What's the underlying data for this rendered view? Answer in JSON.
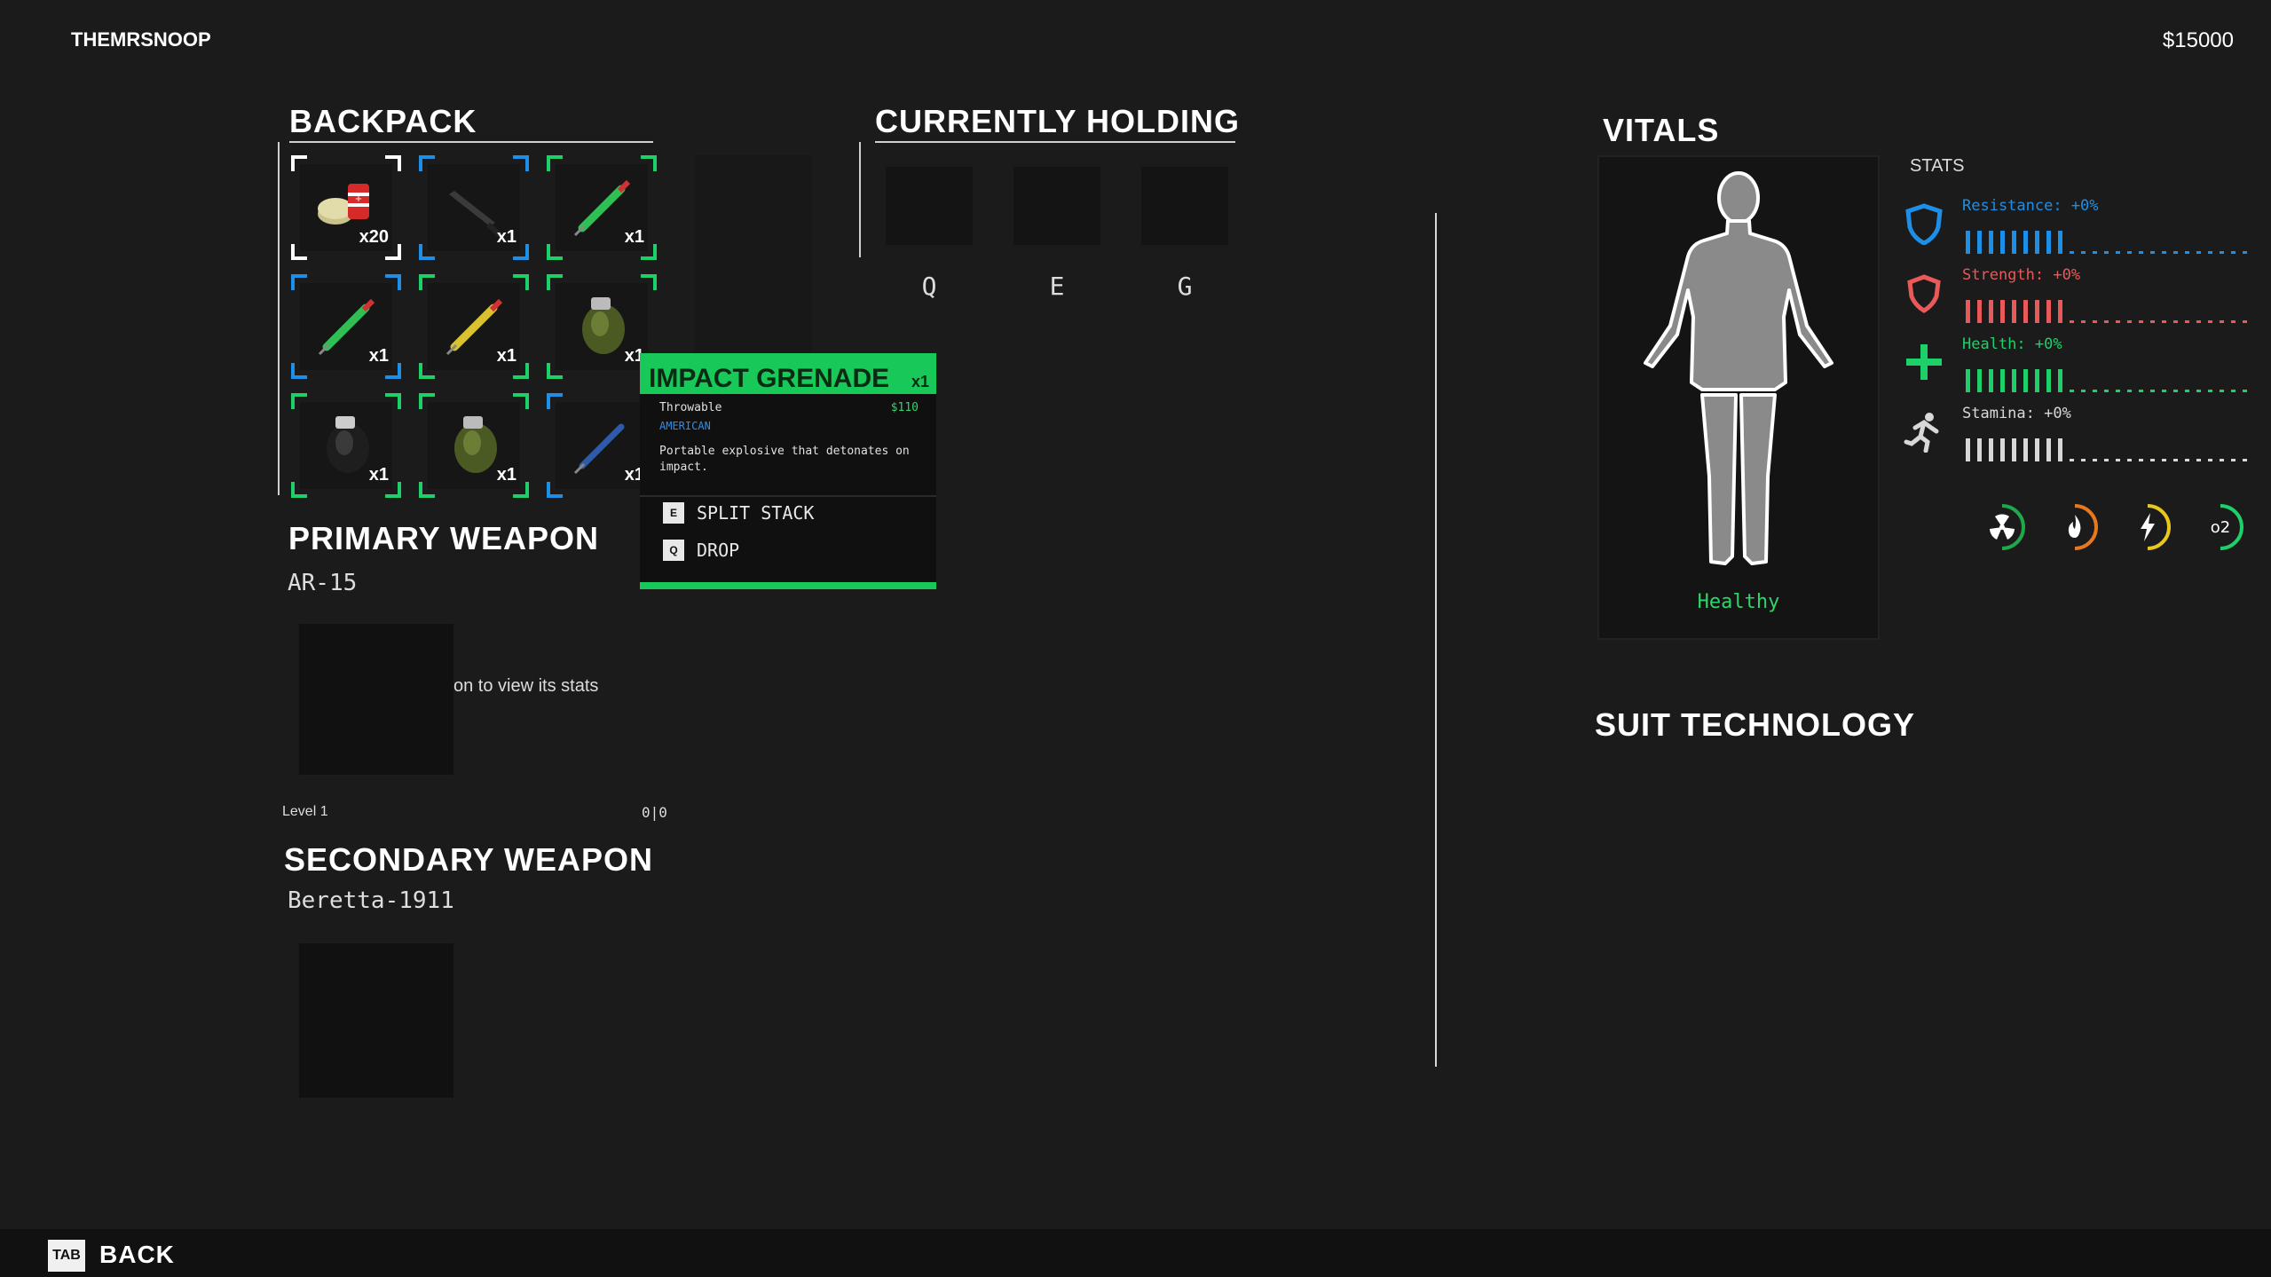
{
  "header": {
    "username": "THEMRSNOOP",
    "money": "$15000"
  },
  "backpack": {
    "title": "BACKPACK",
    "slots": [
      {
        "item": "ammo-cans",
        "qty": "x20",
        "frame_color": "#ffffff"
      },
      {
        "item": "knife",
        "qty": "x1",
        "frame_color": "#1e8fe6"
      },
      {
        "item": "green-syringe",
        "qty": "x1",
        "frame_color": "#1ed06a"
      },
      {
        "item": "green-syringe",
        "qty": "x1",
        "frame_color": "#1e8fe6"
      },
      {
        "item": "yellow-syringe",
        "qty": "x1",
        "frame_color": "#1ed06a"
      },
      {
        "item": "impact-grenade",
        "qty": "x1",
        "frame_color": "#1ed06a"
      },
      {
        "item": "frag-grenade",
        "qty": "x1",
        "frame_color": "#1ed06a"
      },
      {
        "item": "impact-grenade",
        "qty": "x1",
        "frame_color": "#1ed06a"
      },
      {
        "item": "blue-syringe",
        "qty": "x1",
        "frame_color": "#1e8fe6"
      }
    ]
  },
  "holding": {
    "title": "CURRENTLY HOLDING",
    "keys": [
      "Q",
      "E",
      "G"
    ]
  },
  "primary": {
    "title": "PRIMARY WEAPON",
    "name": "AR-15",
    "hint": "on to view its stats",
    "level": "Level 1",
    "ammo": "0|0"
  },
  "secondary": {
    "title": "SECONDARY WEAPON",
    "name": "Beretta-1911"
  },
  "tooltip": {
    "name": "IMPACT GRENADE",
    "qty": "x1",
    "type": "Throwable",
    "price": "$110",
    "origin": "AMERICAN",
    "description": "Portable explosive that detonates on impact.",
    "actions": [
      {
        "key": "E",
        "label": "SPLIT STACK"
      },
      {
        "key": "Q",
        "label": "DROP"
      }
    ],
    "accent": "#18c95a"
  },
  "vitals": {
    "title": "VITALS",
    "status": "Healthy",
    "stats_label": "STATS",
    "stats": [
      {
        "label": "Resistance: +0%",
        "color": "#1e8fe6",
        "icon": "shield-icon",
        "filled": 9,
        "total": 25
      },
      {
        "label": "Strength: +0%",
        "color": "#e85a5a",
        "icon": "strength-shield-icon",
        "filled": 9,
        "total": 25
      },
      {
        "label": "Health: +0%",
        "color": "#1ed06a",
        "icon": "health-cross-icon",
        "filled": 9,
        "total": 25
      },
      {
        "label": "Stamina: +0%",
        "color": "#d8d8d8",
        "icon": "running-man-icon",
        "filled": 9,
        "total": 25
      }
    ],
    "resistances": [
      {
        "icon": "radiation-icon",
        "color": "#1ea84a"
      },
      {
        "icon": "fire-icon",
        "color": "#e8781e"
      },
      {
        "icon": "lightning-icon",
        "color": "#e8c81e"
      },
      {
        "icon": "o2-icon",
        "label": "o2",
        "color": "#1ed06a"
      }
    ]
  },
  "suit": {
    "title": "SUIT TECHNOLOGY"
  },
  "footer": {
    "key": "TAB",
    "label": "BACK"
  }
}
